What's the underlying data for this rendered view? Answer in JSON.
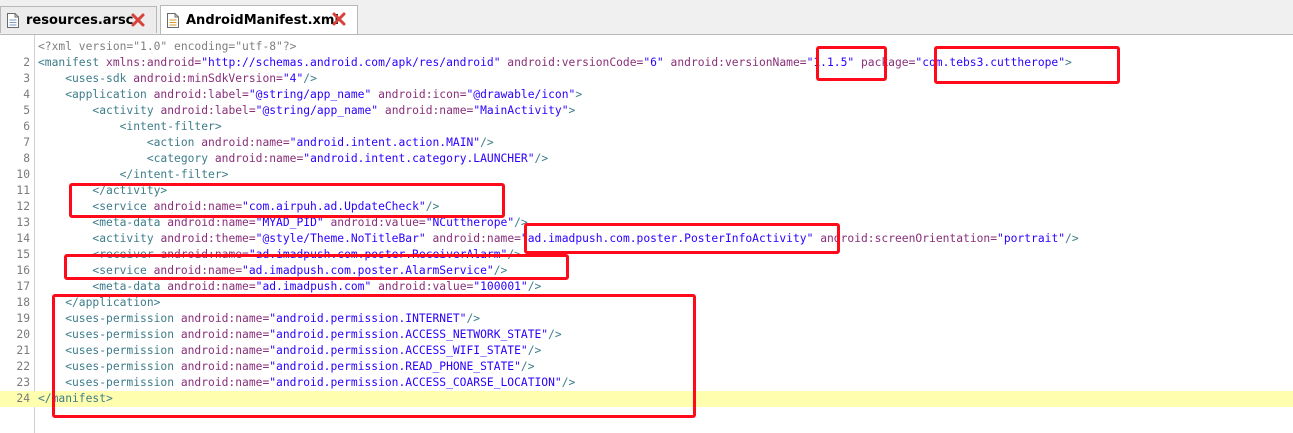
{
  "tabs": [
    {
      "label": "resources.arsc",
      "icon": "file-icon",
      "active": false
    },
    {
      "label": "AndroidManifest.xml",
      "icon": "xml-file-icon",
      "active": true
    }
  ],
  "highlight_color": "#fffdae",
  "annotation_color": "#ff0a1a",
  "lines": [
    {
      "num": "",
      "parts": [
        [
          "pi",
          "<?xml version=\"1.0\" encoding=\"utf-8\"?>"
        ]
      ]
    },
    {
      "num": "2",
      "parts": [
        [
          "t",
          "<manifest "
        ],
        [
          "an",
          "xmlns:android="
        ],
        [
          "av",
          "\"http://schemas.android.com/apk/res/android\""
        ],
        [
          "an",
          " android:versionCode="
        ],
        [
          "av",
          "\"6\""
        ],
        [
          "an",
          " android:versionName="
        ],
        [
          "av",
          "\"1.1.5\""
        ],
        [
          "an",
          " package="
        ],
        [
          "av",
          "\"com.tebs3.cuttherope\""
        ],
        [
          "t",
          ">"
        ]
      ]
    },
    {
      "num": "3",
      "parts": [
        [
          "t",
          "    <uses-sdk "
        ],
        [
          "an",
          "android:minSdkVersion="
        ],
        [
          "av",
          "\"4\""
        ],
        [
          "t",
          "/>"
        ]
      ]
    },
    {
      "num": "4",
      "parts": [
        [
          "t",
          "    <application "
        ],
        [
          "an",
          "android:label="
        ],
        [
          "av",
          "\"@string/app_name\""
        ],
        [
          "an",
          " android:icon="
        ],
        [
          "av",
          "\"@drawable/icon\""
        ],
        [
          "t",
          ">"
        ]
      ]
    },
    {
      "num": "5",
      "parts": [
        [
          "t",
          "        <activity "
        ],
        [
          "an",
          "android:label="
        ],
        [
          "av",
          "\"@string/app_name\""
        ],
        [
          "an",
          " android:name="
        ],
        [
          "av",
          "\"MainActivity\""
        ],
        [
          "t",
          ">"
        ]
      ]
    },
    {
      "num": "6",
      "parts": [
        [
          "t",
          "            <intent-filter>"
        ]
      ]
    },
    {
      "num": "7",
      "parts": [
        [
          "t",
          "                <action "
        ],
        [
          "an",
          "android:name="
        ],
        [
          "av",
          "\"android.intent.action.MAIN\""
        ],
        [
          "t",
          "/>"
        ]
      ]
    },
    {
      "num": "8",
      "parts": [
        [
          "t",
          "                <category "
        ],
        [
          "an",
          "android:name="
        ],
        [
          "av",
          "\"android.intent.category.LAUNCHER\""
        ],
        [
          "t",
          "/>"
        ]
      ]
    },
    {
      "num": "10",
      "parts": [
        [
          "t",
          "            </intent-filter>"
        ]
      ]
    },
    {
      "num": "11",
      "parts": [
        [
          "t",
          "        </activity>"
        ]
      ]
    },
    {
      "num": "12",
      "parts": [
        [
          "t",
          "        <service "
        ],
        [
          "an",
          "android:name="
        ],
        [
          "av",
          "\"com.airpuh.ad.UpdateCheck\""
        ],
        [
          "t",
          "/>"
        ]
      ]
    },
    {
      "num": "13",
      "parts": [
        [
          "t",
          "        <meta-data "
        ],
        [
          "an",
          "android:name="
        ],
        [
          "av",
          "\"MYAD_PID\""
        ],
        [
          "an",
          " android:value="
        ],
        [
          "av",
          "\"NCuttherope\""
        ],
        [
          "t",
          "/>"
        ]
      ]
    },
    {
      "num": "14",
      "parts": [
        [
          "t",
          "        <activity "
        ],
        [
          "an",
          "android:theme="
        ],
        [
          "av",
          "\"@style/Theme.NoTitleBar\""
        ],
        [
          "an",
          " android:name="
        ],
        [
          "av",
          "\"ad.imadpush.com.poster.PosterInfoActivity\""
        ],
        [
          "an",
          " android:screenOrientation="
        ],
        [
          "av",
          "\"portrait\""
        ],
        [
          "t",
          "/>"
        ]
      ]
    },
    {
      "num": "15",
      "parts": [
        [
          "t",
          "        <receiver "
        ],
        [
          "an",
          "android:name="
        ],
        [
          "av",
          "\"ad.imadpush.com.poster.ReceiverAlarm\""
        ],
        [
          "t",
          "/>"
        ]
      ]
    },
    {
      "num": "16",
      "parts": [
        [
          "t",
          "        <service "
        ],
        [
          "an",
          "android:name="
        ],
        [
          "av",
          "\"ad.imadpush.com.poster.AlarmService\""
        ],
        [
          "t",
          "/>"
        ]
      ]
    },
    {
      "num": "17",
      "parts": [
        [
          "t",
          "        <meta-data "
        ],
        [
          "an",
          "android:name="
        ],
        [
          "av",
          "\"ad.imadpush.com\""
        ],
        [
          "an",
          " android:value="
        ],
        [
          "av",
          "\"100001\""
        ],
        [
          "t",
          "/>"
        ]
      ]
    },
    {
      "num": "18",
      "parts": [
        [
          "t",
          "    </application>"
        ]
      ]
    },
    {
      "num": "19",
      "parts": [
        [
          "t",
          "    <uses-permission "
        ],
        [
          "an",
          "android:name="
        ],
        [
          "av",
          "\"android.permission.INTERNET\""
        ],
        [
          "t",
          "/>"
        ]
      ]
    },
    {
      "num": "20",
      "parts": [
        [
          "t",
          "    <uses-permission "
        ],
        [
          "an",
          "android:name="
        ],
        [
          "av",
          "\"android.permission.ACCESS_NETWORK_STATE\""
        ],
        [
          "t",
          "/>"
        ]
      ]
    },
    {
      "num": "21",
      "parts": [
        [
          "t",
          "    <uses-permission "
        ],
        [
          "an",
          "android:name="
        ],
        [
          "av",
          "\"android.permission.ACCESS_WIFI_STATE\""
        ],
        [
          "t",
          "/>"
        ]
      ]
    },
    {
      "num": "22",
      "parts": [
        [
          "t",
          "    <uses-permission "
        ],
        [
          "an",
          "android:name="
        ],
        [
          "av",
          "\"android.permission.READ_PHONE_STATE\""
        ],
        [
          "t",
          "/>"
        ]
      ]
    },
    {
      "num": "23",
      "parts": [
        [
          "t",
          "    <uses-permission "
        ],
        [
          "an",
          "android:name="
        ],
        [
          "av",
          "\"android.permission.ACCESS_COARSE_LOCATION\""
        ],
        [
          "t",
          "/>"
        ]
      ]
    },
    {
      "num": "24",
      "parts": [
        [
          "t",
          "</manifest>"
        ]
      ],
      "highlight": true
    }
  ]
}
